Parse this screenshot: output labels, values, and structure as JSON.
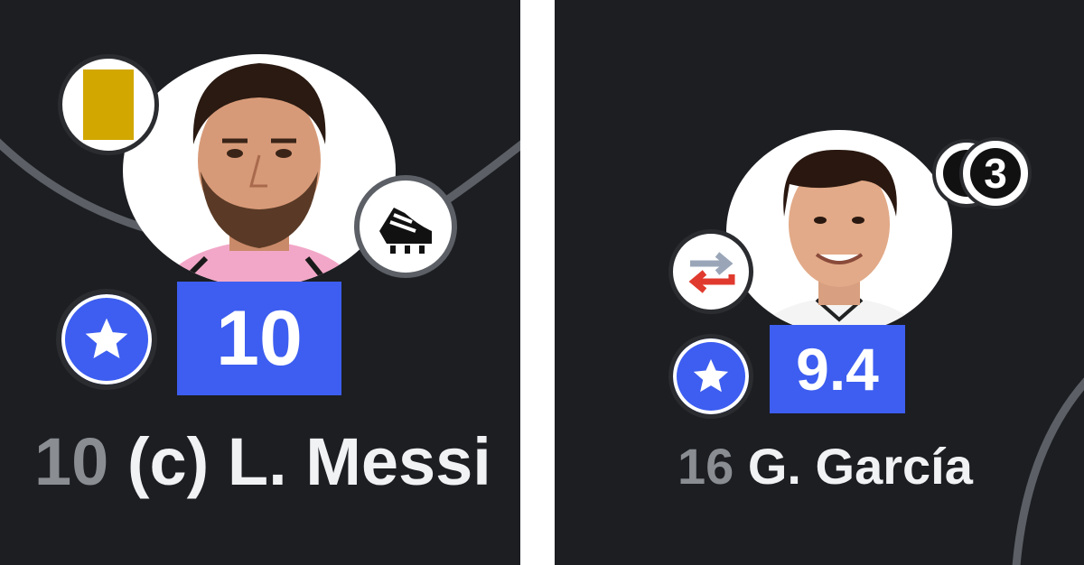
{
  "colors": {
    "background": "#1c1e22",
    "rating_bg": "#3d5ef0",
    "yellow_card": "#d2a700",
    "star_badge": "#3d5ef0",
    "sub_out": "#e03a2e",
    "sub_in": "#9aa6b8",
    "shirt_number": "#8a8d92",
    "name": "#f1f2f4"
  },
  "players": [
    {
      "shirt_number": "10",
      "name": "(c) L. Messi",
      "rating": "10",
      "is_captain": true,
      "badges": [
        "yellow-card-icon",
        "boot-icon",
        "star-icon"
      ]
    },
    {
      "shirt_number": "16",
      "name": "G. García",
      "rating": "9.4",
      "assists_count": "3",
      "badges": [
        "substitution-icon",
        "assist-icon",
        "star-icon"
      ]
    }
  ]
}
